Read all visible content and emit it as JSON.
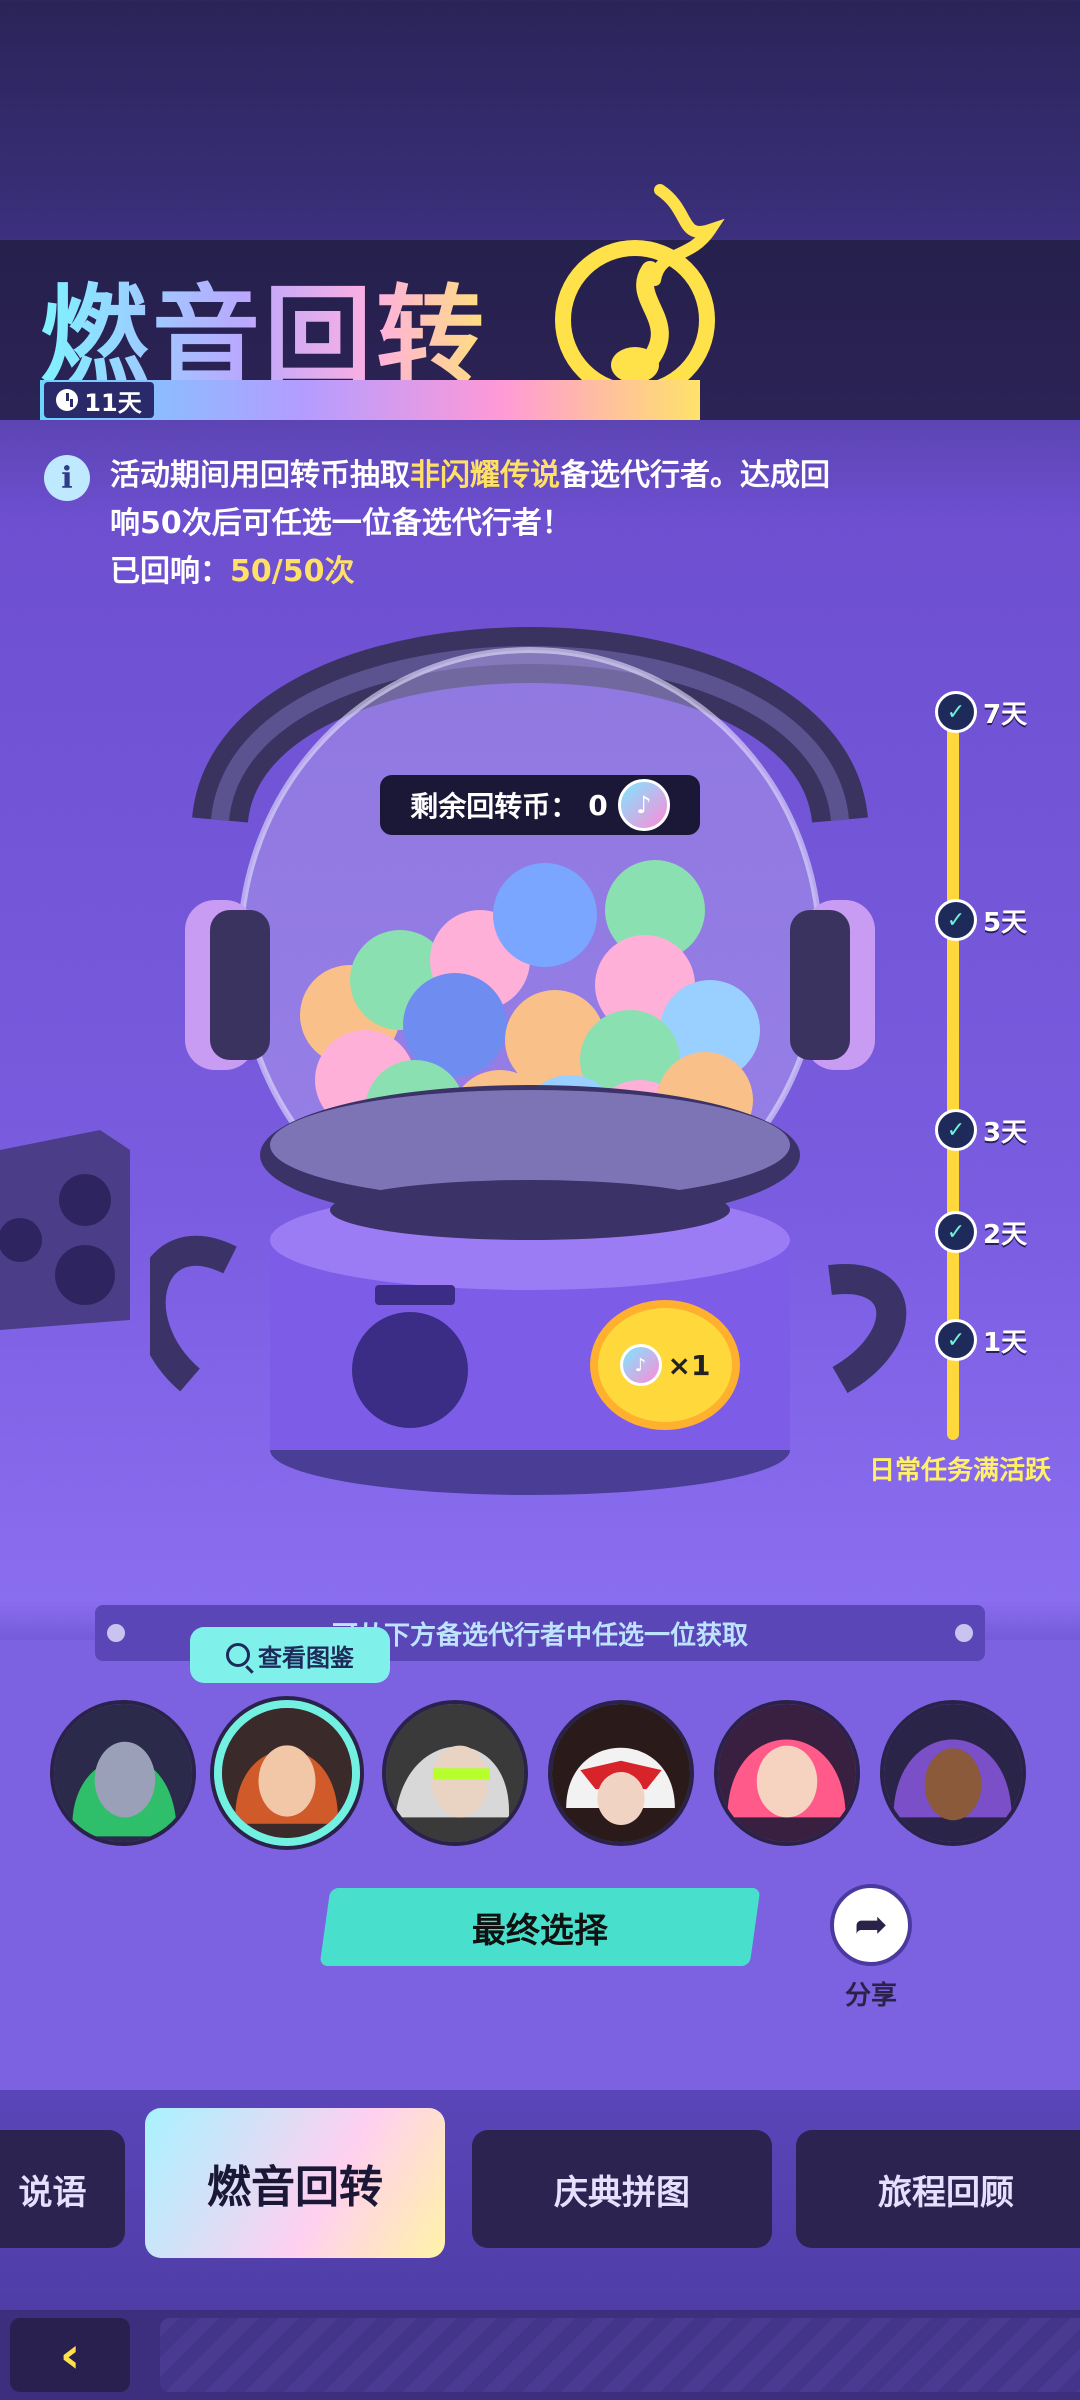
{
  "header": {
    "title": "燃音回转",
    "timer": "11天"
  },
  "info": {
    "line1_pre": "活动期间用回转币抽取",
    "line1_highlight": "非闪耀传说",
    "line1_post": "备选代行者。达成回",
    "line2": "响50次后可任选一位备选代行者！",
    "progress_label": "已回响：",
    "progress_value": "50/50次"
  },
  "machine": {
    "coins_label": "剩余回转币：",
    "coins_value": "0",
    "spin_cost": "×1"
  },
  "progress": {
    "milestones": [
      {
        "label": "7天",
        "checked": true
      },
      {
        "label": "5天",
        "checked": true
      },
      {
        "label": "3天",
        "checked": true
      },
      {
        "label": "2天",
        "checked": true
      },
      {
        "label": "1天",
        "checked": true
      }
    ],
    "caption": "日常任务满活跃"
  },
  "selection": {
    "banner": "可从下方备选代行者中任选一位获取",
    "view_gallery": "查看图鉴",
    "final_button": "最终选择",
    "share_label": "分享",
    "selected_index": 1
  },
  "tabs": [
    {
      "label": "说语"
    },
    {
      "label": "燃音回转"
    },
    {
      "label": "庆典拼图"
    },
    {
      "label": "旅程回顾"
    }
  ],
  "colors": {
    "accent_yellow": "#ffe066",
    "accent_teal": "#48e0cc",
    "panel_purple": "#7c62e0"
  }
}
